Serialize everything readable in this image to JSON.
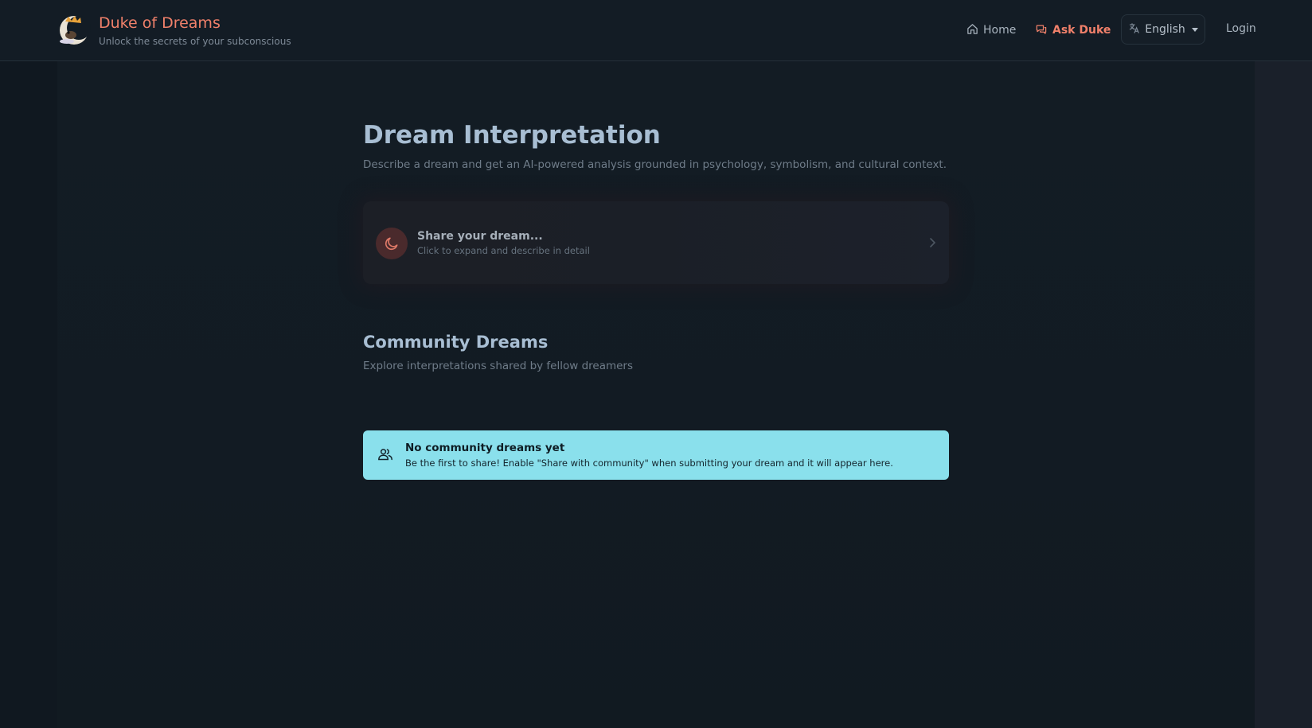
{
  "header": {
    "brand_title": "Duke of Dreams",
    "brand_tagline": "Unlock the secrets of your subconscious",
    "logo_icon": "crescent-moon-logo-icon",
    "nav": {
      "home_label": "Home",
      "ask_label": "Ask Duke",
      "language_label": "English",
      "login_label": "Login"
    }
  },
  "main": {
    "title": "Dream Interpretation",
    "subtitle": "Describe a dream and get an AI-powered analysis grounded in psychology, symbolism, and cultural context.",
    "dream_card": {
      "title": "Share your dream...",
      "subtitle": "Click to expand and describe in detail",
      "icon": "moon-icon"
    },
    "community": {
      "title": "Community Dreams",
      "subtitle": "Explore interpretations shared by fellow dreamers",
      "empty_title": "No community dreams yet",
      "empty_text": "Be the first to share! Enable \"Share with community\" when submitting your dream and it will appear here.",
      "icon": "users-icon"
    }
  },
  "colors": {
    "accent": "#f0806a",
    "background": "#111a22",
    "alert_bg": "#8ae0ec"
  }
}
